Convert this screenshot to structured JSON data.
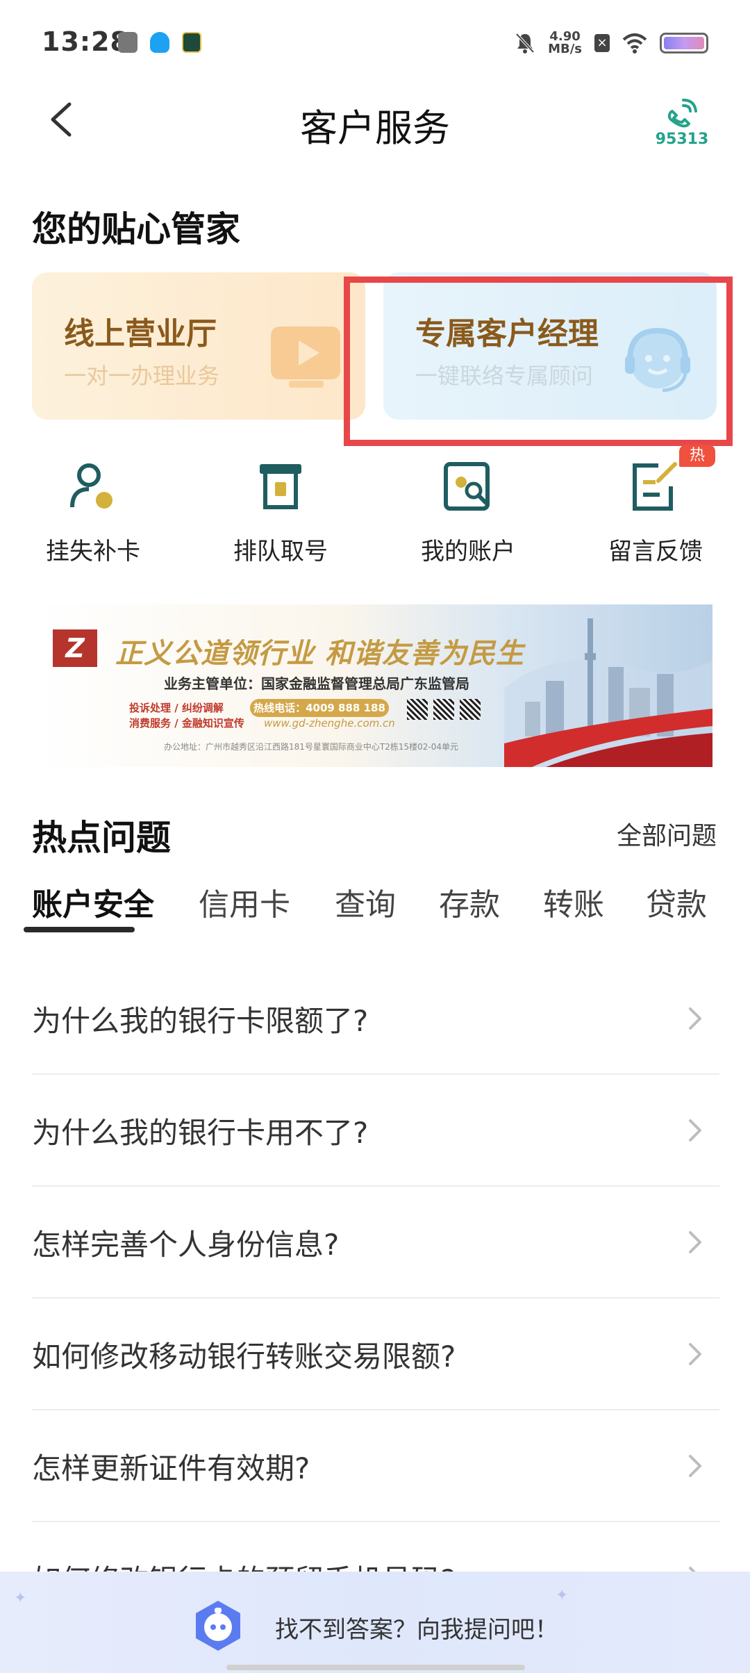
{
  "status_bar": {
    "time": "13:28",
    "net_speed_value": "4.90",
    "net_speed_unit": "MB/s"
  },
  "header": {
    "title": "客户服务",
    "phone_number": "95313"
  },
  "butler": {
    "title": "您的贴心管家",
    "cards": [
      {
        "title": "线上营业厅",
        "subtitle": "一对一办理业务"
      },
      {
        "title": "专属客户经理",
        "subtitle": "一键联络专属顾问"
      }
    ]
  },
  "quick_entries": [
    {
      "label": "挂失补卡",
      "icon": "user-lock-icon"
    },
    {
      "label": "排队取号",
      "icon": "queue-ticket-icon"
    },
    {
      "label": "我的账户",
      "icon": "account-search-icon"
    },
    {
      "label": "留言反馈",
      "icon": "feedback-edit-icon"
    }
  ],
  "hot_badge": "热",
  "banner": {
    "slogan": "正义公道领行业  和谐友善为民生",
    "line2": "业务主管单位：国家金融监督管理总局广东监管局",
    "tags_1": "投诉处理 / 纠纷调解",
    "tags_2": "消费服务 / 金融知识宣传",
    "hotline": "热线电话：4009 888 188",
    "website": "www.gd-zhenghe.com.cn",
    "address": "办公地址：广州市越秀区沿江西路181号星寰国际商业中心T2栋15楼02-04单元"
  },
  "hot_issues": {
    "title": "热点问题",
    "all_link": "全部问题",
    "tabs": [
      "账户安全",
      "信用卡",
      "查询",
      "存款",
      "转账",
      "贷款"
    ],
    "active_tab": "账户安全",
    "questions": [
      "为什么我的银行卡限额了?",
      "为什么我的银行卡用不了?",
      "怎样完善个人身份信息?",
      "如何修改移动银行转账交易限额?",
      "怎样更新证件有效期?",
      "如何修改银行卡的预留手机号码?"
    ]
  },
  "assistant": {
    "text": "找不到答案？向我提问吧！"
  },
  "colors": {
    "accent_green": "#23a38a",
    "highlight_red": "#e8474a",
    "card_title_brown": "#8a5a1c",
    "hot_red": "#f0503e"
  }
}
